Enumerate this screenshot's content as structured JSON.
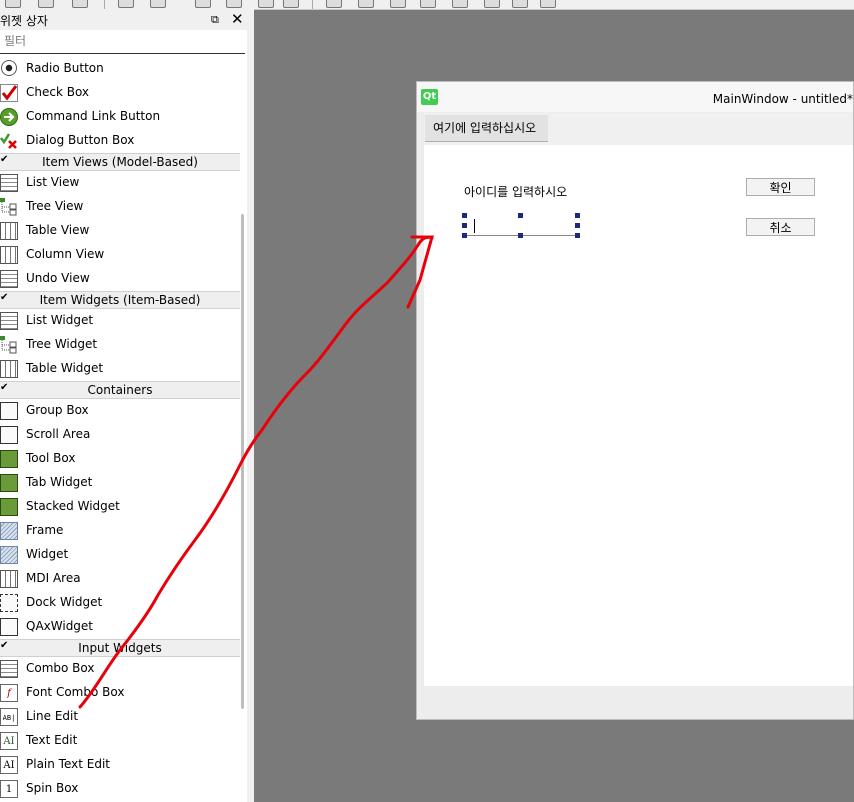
{
  "panel": {
    "title": "위젯 상자",
    "float_icon": "⧉",
    "close_icon": "✕",
    "filter_placeholder": "필터"
  },
  "items": {
    "radio_button": "Radio Button",
    "check_box": "Check Box",
    "command_link_button": "Command Link Button",
    "dialog_button_box": "Dialog Button Box",
    "list_view": "List View",
    "tree_view": "Tree View",
    "table_view": "Table View",
    "column_view": "Column View",
    "undo_view": "Undo View",
    "list_widget": "List Widget",
    "tree_widget": "Tree Widget",
    "table_widget": "Table Widget",
    "group_box": "Group Box",
    "scroll_area": "Scroll Area",
    "tool_box": "Tool Box",
    "tab_widget": "Tab Widget",
    "stacked_widget": "Stacked Widget",
    "frame": "Frame",
    "widget": "Widget",
    "mdi_area": "MDI Area",
    "dock_widget": "Dock Widget",
    "qax_widget": "QAxWidget",
    "combo_box": "Combo Box",
    "font_combo_box": "Font Combo Box",
    "line_edit": "Line Edit",
    "text_edit": "Text Edit",
    "plain_text_edit": "Plain Text Edit",
    "spin_box": "Spin Box"
  },
  "categories": {
    "item_views": "Item Views (Model-Based)",
    "item_widgets": "Item Widgets (Item-Based)",
    "containers": "Containers",
    "input_widgets": "Input Widgets"
  },
  "form": {
    "logo": "Qt",
    "title": "MainWindow - untitled*",
    "menu_item": "여기에 입력하십시오",
    "label": "아이디를 입력하시오",
    "ok_button": "확인",
    "cancel_button": "취소"
  },
  "colors": {
    "annotation": "#e8000a",
    "qt_green": "#41cd52",
    "selection_handle": "#1a2a7a"
  }
}
